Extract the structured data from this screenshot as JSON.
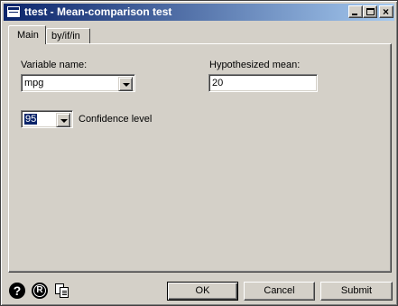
{
  "window": {
    "title": "ttest - Mean-comparison test"
  },
  "tabs": [
    {
      "label": "Main",
      "active": true
    },
    {
      "label": "by/if/in",
      "active": false
    }
  ],
  "main": {
    "variable_name": {
      "label": "Variable name:",
      "value": "mpg"
    },
    "hypothesized_mean": {
      "label": "Hypothesized mean:",
      "value": "20"
    },
    "confidence": {
      "value": "95",
      "label": "Confidence level"
    }
  },
  "footer": {
    "icons": [
      "help-icon",
      "reset-icon",
      "copy-icon"
    ],
    "ok_label": "OK",
    "cancel_label": "Cancel",
    "submit_label": "Submit"
  },
  "colors": {
    "titlebar_start": "#0a246a",
    "titlebar_end": "#a6caf0",
    "face": "#d4d0c8",
    "selection": "#0a246a"
  }
}
